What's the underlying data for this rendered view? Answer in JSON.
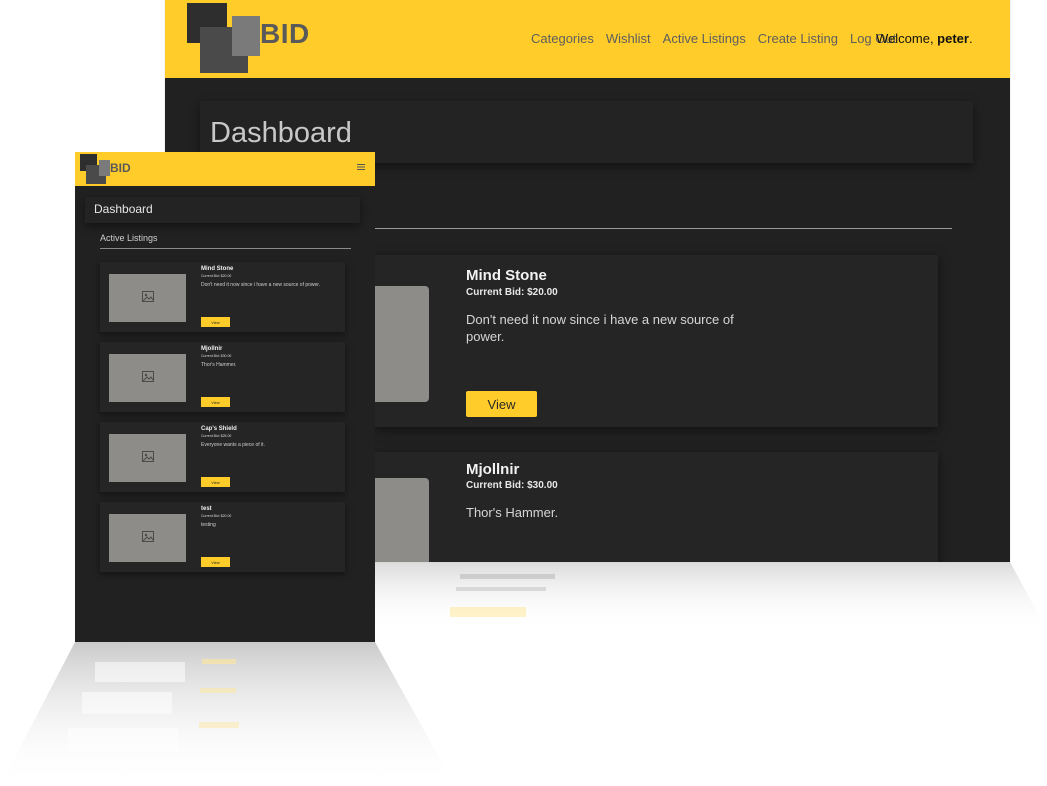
{
  "brand": {
    "name": "BID"
  },
  "colors": {
    "accent": "#ffcc29",
    "surface": "#212121",
    "card": "#252525",
    "placeholder": "#8e8c89"
  },
  "desktop": {
    "nav": {
      "links": [
        "Categories",
        "Wishlist",
        "Active Listings",
        "Create Listing",
        "Log Out"
      ]
    },
    "welcome": {
      "prefix": "Welcome, ",
      "user": "peter",
      "suffix": "."
    },
    "page_title": "Dashboard",
    "listings": [
      {
        "title": "Mind Stone",
        "bid": "Current Bid: $20.00",
        "description": "Don't need it now since i have a new source of power.",
        "button": "View"
      },
      {
        "title": "Mjollnir",
        "bid": "Current Bid: $30.00",
        "description": "Thor's Hammer."
      }
    ]
  },
  "mobile": {
    "menu_icon": "hamburger-icon",
    "page_title": "Dashboard",
    "section_title": "Active Listings",
    "listings": [
      {
        "title": "Mind Stone",
        "bid": "Current Bid: $20.00",
        "description": "Don't need it now since i have a new source of power.",
        "button": "View"
      },
      {
        "title": "Mjollnir",
        "bid": "Current Bid: $30.00",
        "description": "Thor's Hammer.",
        "button": "View"
      },
      {
        "title": "Cap's Shield",
        "bid": "Current Bid: $25.00",
        "description": "Everyone wants a piece of it.",
        "button": "View"
      },
      {
        "title": "test",
        "bid": "Current Bid: $20.00",
        "description": "testing",
        "button": "View"
      }
    ]
  }
}
